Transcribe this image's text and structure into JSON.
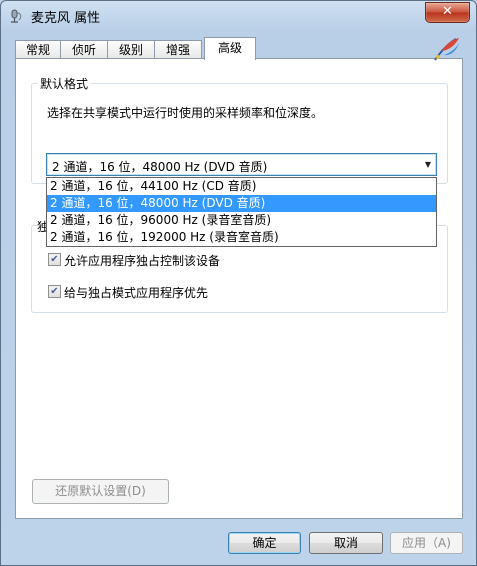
{
  "window": {
    "title": "麦克风 属性",
    "close_label": "✕"
  },
  "tabs": [
    {
      "label": "常规"
    },
    {
      "label": "侦听"
    },
    {
      "label": "级别"
    },
    {
      "label": "增强"
    },
    {
      "label": "高级"
    }
  ],
  "active_tab": "高级",
  "default_format": {
    "group_label": "默认格式",
    "description": "选择在共享模式中运行时使用的采样频率和位深度。",
    "selected": "2 通道，16 位，48000 Hz (DVD 音质)",
    "options": [
      "2 通道，16 位，44100 Hz (CD 音质)",
      "2 通道，16 位，48000 Hz (DVD 音质)",
      "2 通道，16 位，96000 Hz (录音室音质)",
      "2 通道，16 位，192000 Hz (录音室音质)"
    ]
  },
  "exclusive_mode": {
    "group_label_partial": "独",
    "allow_exclusive": {
      "label": "允许应用程序独占控制该设备",
      "checked": true
    },
    "give_priority": {
      "label": "给与独占模式应用程序优先",
      "checked": true
    }
  },
  "restore_defaults_label": "还原默认设置(D)",
  "footer": {
    "ok_label": "确定",
    "cancel_label": "取消",
    "apply_label": "应用（A)"
  },
  "colors": {
    "selection": "#3399ff",
    "close_button": "#c8523a",
    "frame": "#bcd3ea"
  }
}
